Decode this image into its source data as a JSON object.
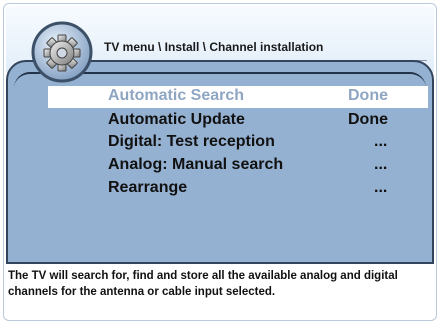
{
  "header": {
    "breadcrumb": "TV menu \\ Install \\ Channel installation"
  },
  "menu": {
    "items": [
      {
        "label": "Automatic Search",
        "status": "Done",
        "selected": true
      },
      {
        "label": "Automatic Update",
        "status": "Done",
        "selected": false
      },
      {
        "label": "Digital: Test reception",
        "status": "...",
        "selected": false
      },
      {
        "label": "Analog: Manual search",
        "status": "...",
        "selected": false
      },
      {
        "label": "Rearrange",
        "status": "...",
        "selected": false
      }
    ]
  },
  "footer": {
    "help_text": "The TV will search for, find and store all the available analog and digital channels for the antenna or cable input selected."
  },
  "colors": {
    "panel": "#95b1d2",
    "selected_row": "#ffffff",
    "border": "#33455d"
  },
  "icons": {
    "header_icon": "gear-icon"
  }
}
